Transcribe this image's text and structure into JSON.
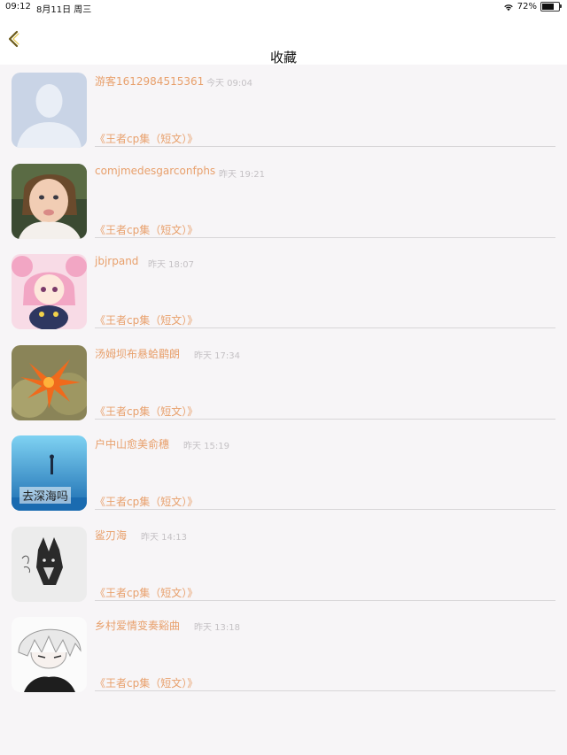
{
  "status_bar": {
    "time": "09:12",
    "date": "8月11日 周三",
    "battery": "72%",
    "battery_level": 0.72
  },
  "nav": {
    "title": "收藏"
  },
  "colors": {
    "accent": "#e8a06c",
    "muted": "#c4c1c4"
  },
  "items": [
    {
      "username": "游客1612984515361",
      "time": "今天 09:04",
      "book": "《王者cp集（短文）》"
    },
    {
      "username": "comjmedesgarconfphs",
      "time": "昨天 19:21",
      "book": "《王者cp集（短文）》"
    },
    {
      "username": "jbjrpand",
      "time": "昨天 18:07",
      "book": "《王者cp集（短文）》"
    },
    {
      "username": "汤姆坝布悬蛤鹛朗",
      "time": "昨天 17:34",
      "book": "《王者cp集（短文）》"
    },
    {
      "username": "户中山愈美俞穗",
      "time": "昨天 15:19",
      "book": "《王者cp集（短文）》",
      "avatar_text": "去深海吗"
    },
    {
      "username": "鲨刃海",
      "time": "昨天 14:13",
      "book": "《王者cp集（短文）》"
    },
    {
      "username": "乡村爱情变奏谿曲",
      "time": "昨天 13:18",
      "book": "《王者cp集（短文）》"
    }
  ]
}
